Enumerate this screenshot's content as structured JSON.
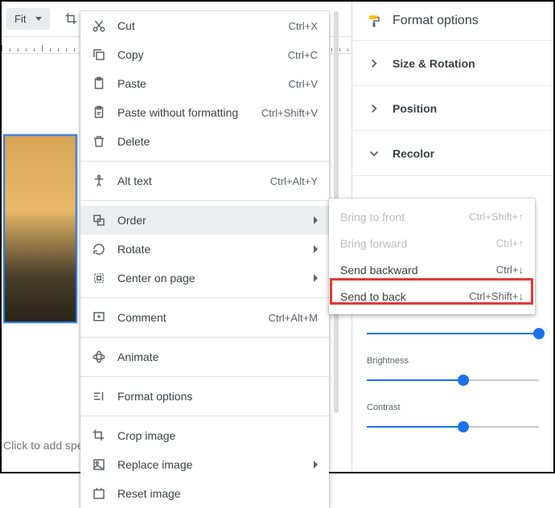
{
  "toolbar": {
    "fit_label": "Fit"
  },
  "placeholder": "Click to add spe",
  "context_menu": {
    "items": [
      {
        "label": "Cut",
        "shortcut": "Ctrl+X",
        "icon": "cut"
      },
      {
        "label": "Copy",
        "shortcut": "Ctrl+C",
        "icon": "copy"
      },
      {
        "label": "Paste",
        "shortcut": "Ctrl+V",
        "icon": "paste"
      },
      {
        "label": "Paste without formatting",
        "shortcut": "Ctrl+Shift+V",
        "icon": "paste-plain"
      },
      {
        "label": "Delete",
        "shortcut": "",
        "icon": "trash"
      }
    ],
    "alt_text": {
      "label": "Alt text",
      "shortcut": "Ctrl+Alt+Y"
    },
    "order": {
      "label": "Order"
    },
    "rotate": {
      "label": "Rotate"
    },
    "center": {
      "label": "Center on page"
    },
    "comment": {
      "label": "Comment",
      "shortcut": "Ctrl+Alt+M"
    },
    "animate": {
      "label": "Animate"
    },
    "format_options": {
      "label": "Format options"
    },
    "crop": {
      "label": "Crop image"
    },
    "replace": {
      "label": "Replace image"
    },
    "reset": {
      "label": "Reset image"
    }
  },
  "order_submenu": {
    "bring_front": {
      "label": "Bring to front",
      "shortcut": "Ctrl+Shift+↑"
    },
    "bring_forward": {
      "label": "Bring forward",
      "shortcut": "Ctrl+↑"
    },
    "send_backward": {
      "label": "Send backward",
      "shortcut": "Ctrl+↓"
    },
    "send_back": {
      "label": "Send to back",
      "shortcut": "Ctrl+Shift+↓"
    }
  },
  "sidebar": {
    "title": "Format options",
    "size_rotation": "Size & Rotation",
    "position": "Position",
    "recolor": "Recolor",
    "brightness": "Brightness",
    "contrast": "Contrast"
  }
}
